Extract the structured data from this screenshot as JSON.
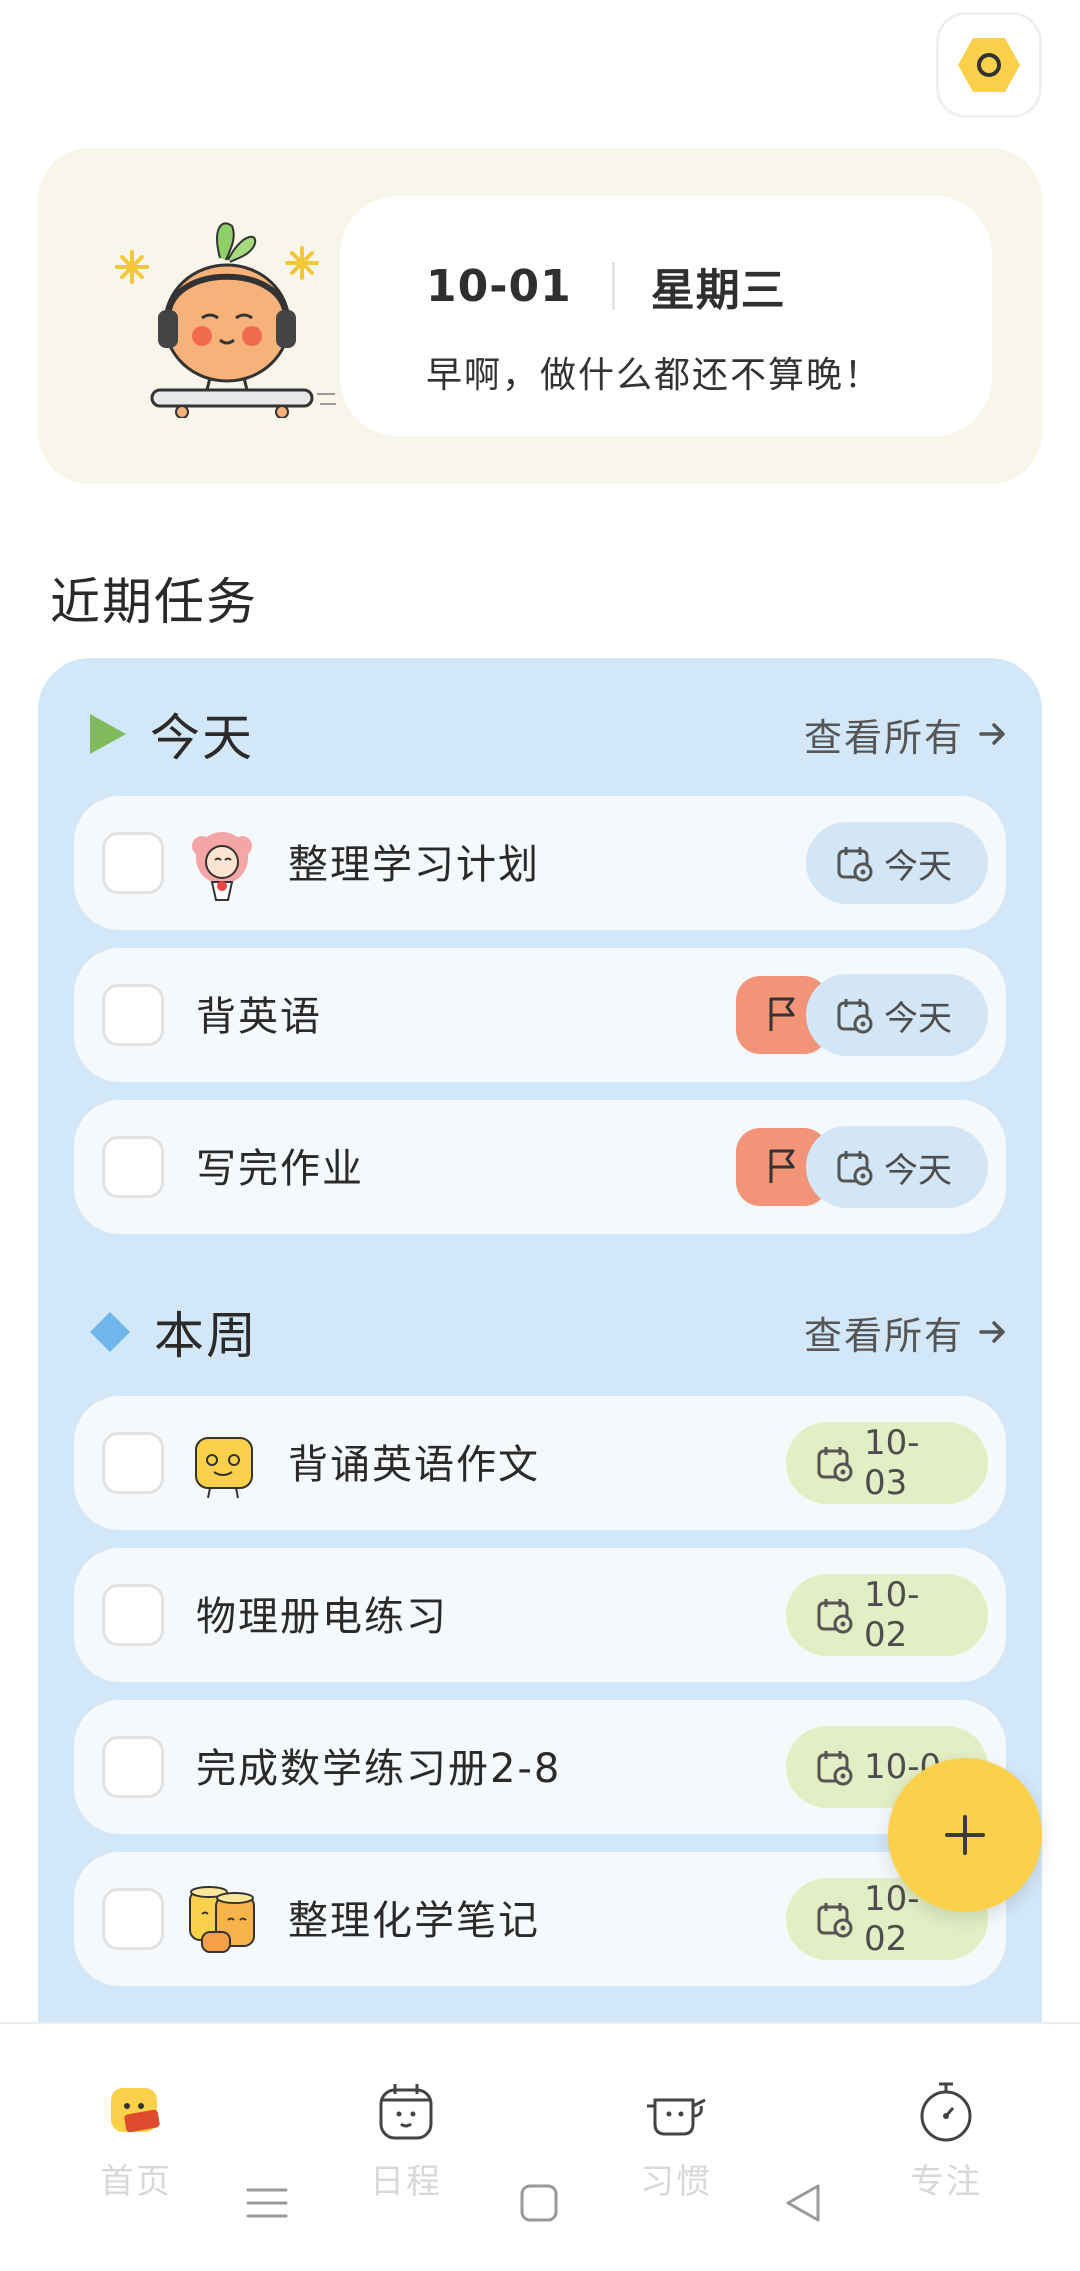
{
  "header": {
    "settings_icon": "hexagon-settings-icon"
  },
  "hero": {
    "date": "10-01",
    "weekday": "星期三",
    "greeting": "早啊，做什么都还不算晚！"
  },
  "section_title": "近期任务",
  "today": {
    "title": "今天",
    "view_all": "查看所有",
    "tasks": [
      {
        "label": "整理学习计划",
        "chip": "今天"
      },
      {
        "label": "背英语",
        "chip": "今天",
        "flag": "flag-icon"
      },
      {
        "label": "写完作业",
        "chip": "今天",
        "flag": "flag-icon"
      }
    ]
  },
  "week": {
    "title": "本周",
    "view_all": "查看所有",
    "tasks": [
      {
        "label": "背诵英语作文",
        "chip": "10-03"
      },
      {
        "label": "物理册电练习",
        "chip": "10-02"
      },
      {
        "label": "完成数学练习册2-8",
        "chip": "10-0"
      },
      {
        "label": "整理化学笔记",
        "chip": "10-02"
      }
    ]
  },
  "nav": {
    "items": [
      {
        "label": "首页",
        "icon": "home-icon"
      },
      {
        "label": "日程",
        "icon": "schedule-icon"
      },
      {
        "label": "习惯",
        "icon": "habit-icon"
      },
      {
        "label": "专注",
        "icon": "focus-timer-icon"
      }
    ]
  },
  "colors": {
    "accent_yellow": "#fbd14b",
    "panel_blue": "#d2e7f8",
    "flag_red": "#f29478",
    "today_chip": "#d3e6f6",
    "week_chip": "#e3eec4"
  }
}
